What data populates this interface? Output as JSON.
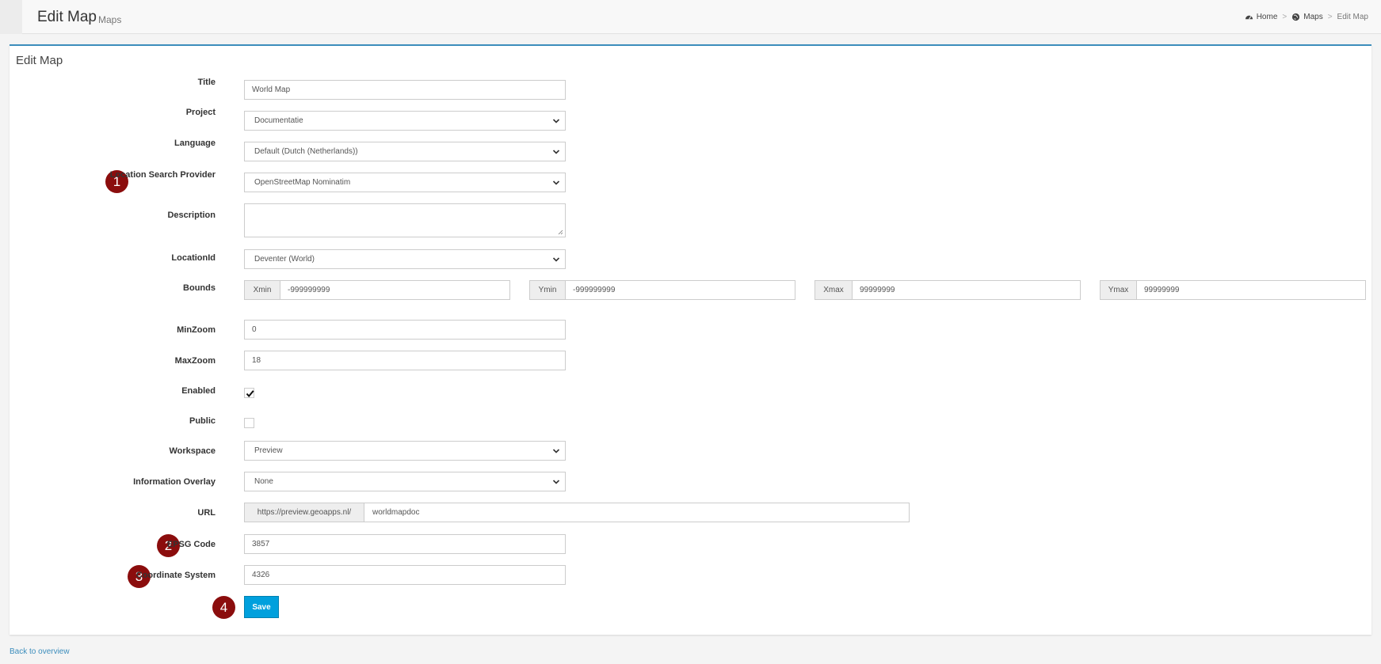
{
  "header": {
    "title": "Edit Map",
    "subtitle": "Maps",
    "breadcrumb": {
      "home": "Home",
      "maps": "Maps",
      "current": "Edit Map"
    }
  },
  "form": {
    "heading": "Edit Map",
    "title": {
      "label": "Title",
      "value": "World Map"
    },
    "project": {
      "label": "Project",
      "value": "Documentatie"
    },
    "language": {
      "label": "Language",
      "value": "Default (Dutch (Netherlands))"
    },
    "location_search_provider": {
      "label": "Location Search Provider",
      "value": "OpenStreetMap Nominatim"
    },
    "description": {
      "label": "Description",
      "value": ""
    },
    "location_id": {
      "label": "LocationId",
      "value": "Deventer (World)"
    },
    "bounds": {
      "label": "Bounds",
      "xmin": {
        "addon": "Xmin",
        "value": "-999999999"
      },
      "ymin": {
        "addon": "Ymin",
        "value": "-999999999"
      },
      "xmax": {
        "addon": "Xmax",
        "value": "99999999"
      },
      "ymax": {
        "addon": "Ymax",
        "value": "99999999"
      }
    },
    "min_zoom": {
      "label": "MinZoom",
      "value": "0"
    },
    "max_zoom": {
      "label": "MaxZoom",
      "value": "18"
    },
    "enabled": {
      "label": "Enabled",
      "checked": true
    },
    "public": {
      "label": "Public",
      "checked": false
    },
    "workspace": {
      "label": "Workspace",
      "value": "Preview"
    },
    "information_overlay": {
      "label": "Information Overlay",
      "value": "None"
    },
    "url": {
      "label": "URL",
      "prefix": "https://preview.geoapps.nl/",
      "value": "worldmapdoc"
    },
    "epsg_code": {
      "label": "EPSG Code",
      "value": "3857"
    },
    "coordinate_system": {
      "label": "Coordinate System",
      "value": "4326"
    },
    "save_label": "Save"
  },
  "markers": [
    "1",
    "2",
    "3",
    "4"
  ],
  "footer": {
    "back_link": "Back to overview"
  },
  "colors": {
    "accent": "#3c8dbc",
    "save_button": "#00a0dd",
    "marker": "#8b0d0d"
  }
}
